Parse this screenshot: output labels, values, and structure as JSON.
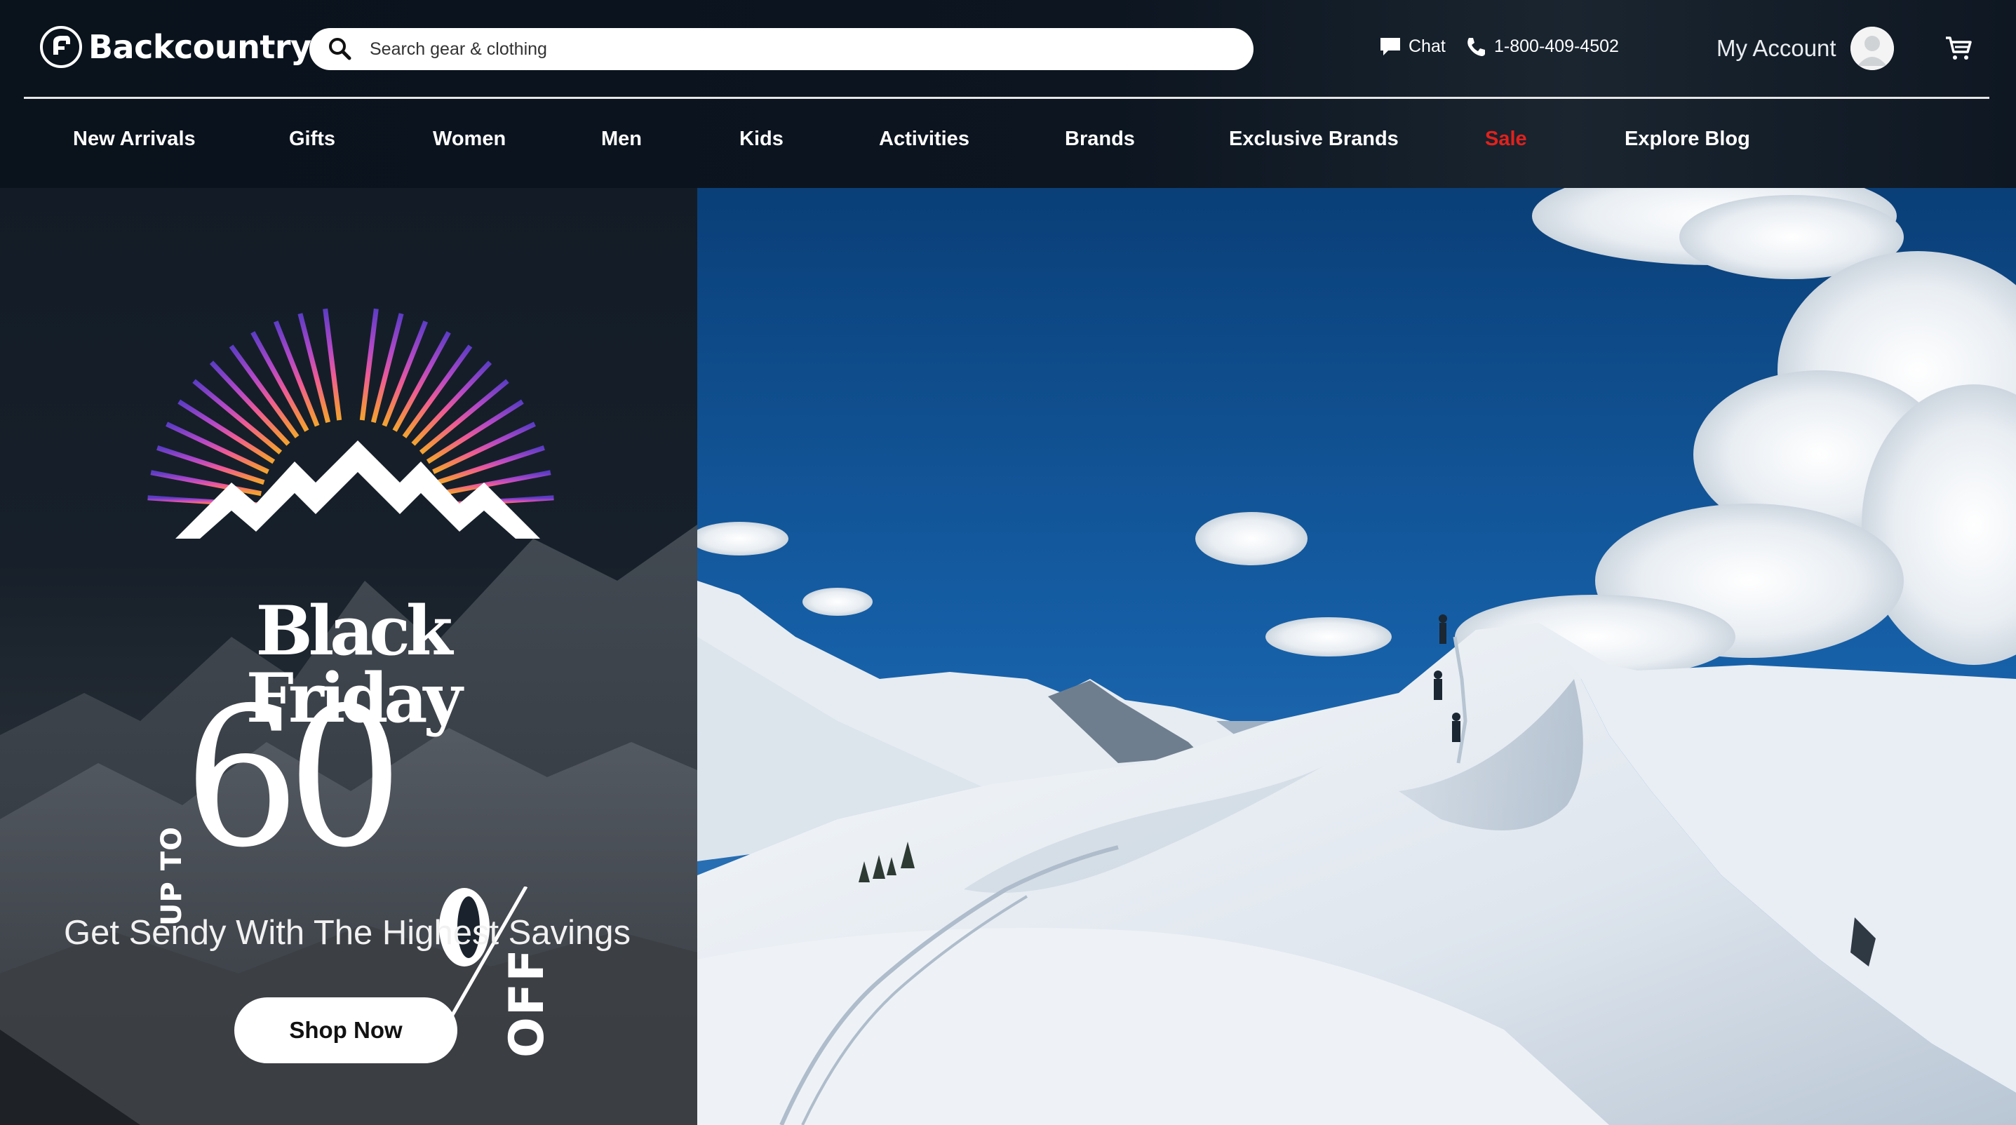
{
  "brand": {
    "name": "Backcountry"
  },
  "search": {
    "placeholder": "Search gear & clothing"
  },
  "utility": {
    "chat_label": "Chat",
    "phone_label": "1-800-409-4502"
  },
  "account": {
    "label": "My Account"
  },
  "nav": {
    "items": [
      {
        "label": "New Arrivals"
      },
      {
        "label": "Gifts"
      },
      {
        "label": "Women"
      },
      {
        "label": "Men"
      },
      {
        "label": "Kids"
      },
      {
        "label": "Activities"
      },
      {
        "label": "Brands"
      },
      {
        "label": "Exclusive Brands"
      },
      {
        "label": "Sale"
      },
      {
        "label": "Explore Blog"
      }
    ]
  },
  "hero": {
    "title": "Black Friday",
    "discount_prefix": "UP TO",
    "discount_value": "60",
    "discount_suffix": "OFF",
    "tagline": "Get Sendy With The Highest Savings",
    "cta_label": "Shop Now"
  },
  "icons": {
    "logo": "backcountry-goat-logo-icon",
    "search": "search-icon",
    "chat": "chat-bubble-icon",
    "phone": "phone-icon",
    "avatar": "user-avatar-icon",
    "cart": "cart-icon"
  },
  "colors": {
    "header_bg": "#0b1119",
    "sale": "#e3211c",
    "sky": "#0f4f8c",
    "snow": "#eef2f6",
    "cta_bg": "#ffffff"
  }
}
